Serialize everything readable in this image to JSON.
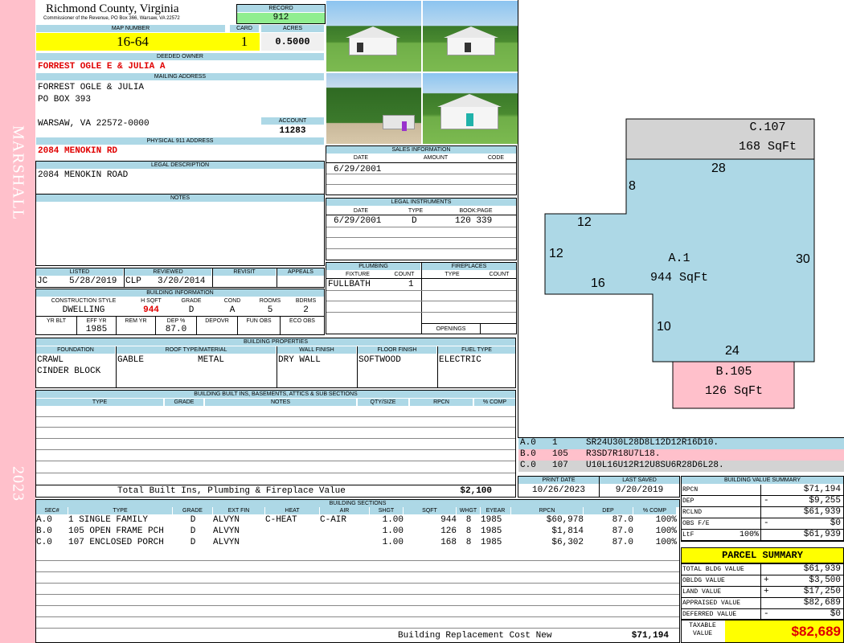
{
  "sidebar": {
    "district": "MARSHALL",
    "year": "2023"
  },
  "county": {
    "name": "Richmond County, Virginia",
    "commissioner": "Commissioner of the Revenue, PO Box 366, Warsaw, VA 22572"
  },
  "record": {
    "label": "RECORD",
    "value": "912"
  },
  "map_number": {
    "label": "MAP NUMBER",
    "value": "16-64"
  },
  "card": {
    "label": "CARD",
    "value": "1"
  },
  "acres": {
    "label": "ACRES",
    "value": "0.5000"
  },
  "deeded_owner": {
    "label": "DEEDED OWNER",
    "value": "FORREST OGLE E & JULIA A"
  },
  "mailing": {
    "label": "MAILING ADDRESS",
    "line1": "FORREST OGLE & JULIA",
    "line2": "PO BOX 393",
    "line3": "WARSAW, VA 22572-0000"
  },
  "account": {
    "label": "ACCOUNT",
    "value": "11283"
  },
  "physical": {
    "label": "PHYSICAL 911 ADDRESS",
    "value": "2084 MENOKIN RD"
  },
  "legal": {
    "label": "LEGAL DESCRIPTION",
    "value": "2084 MENOKIN ROAD"
  },
  "notes": {
    "label": "NOTES"
  },
  "sales": {
    "title": "SALES INFORMATION",
    "h_date": "DATE",
    "h_amount": "AMOUNT",
    "h_code": "CODE",
    "date": "6/29/2001"
  },
  "instruments": {
    "title": "LEGAL INSTRUMENTS",
    "h_date": "DATE",
    "h_type": "TYPE",
    "h_book": "BOOK:PAGE",
    "date": "6/29/2001",
    "type": "D",
    "book": "120 339"
  },
  "listing": {
    "h_listed": "LISTED",
    "h_reviewed": "REVIEWED",
    "h_revisit": "REVISIT",
    "h_appeals": "APPEALS",
    "listed_by": "JC",
    "listed_date": "5/28/2019",
    "reviewed_by": "CLP",
    "reviewed_date": "3/20/2014"
  },
  "plumbing": {
    "title": "PLUMBING",
    "h_fixture": "FIXTURE",
    "h_count": "COUNT",
    "fixture": "FULLBATH",
    "count": "1"
  },
  "fireplaces": {
    "title": "FIREPLACES",
    "h_type": "TYPE",
    "h_count": "COUNT",
    "openings": "OPENINGS"
  },
  "building_info": {
    "title": "BUILDING INFORMATION",
    "h_style": "CONSTRUCTION STYLE",
    "h_sqft": "H SQFT",
    "h_grade": "GRADE",
    "h_cond": "COND",
    "h_rooms": "ROOMS",
    "h_bdrms": "BDRMS",
    "style": "DWELLING",
    "sqft": "944",
    "grade": "D",
    "cond": "A",
    "rooms": "5",
    "bdrms": "2",
    "h_yrblt": "YR BLT",
    "h_effyr": "EFF YR",
    "h_remyr": "REM YR",
    "h_dep": "DEP %",
    "h_depovr": "DEPOVR",
    "h_funobs": "FUN OBS",
    "h_ecoobs": "ECO OBS",
    "effyr": "1985",
    "dep": "87.0"
  },
  "properties": {
    "title": "BUILDING PROPERTIES",
    "h_foundation": "FOUNDATION",
    "h_roof": "ROOF TYPE/MATERIAL",
    "h_wall": "WALL FINISH",
    "h_floor": "FLOOR FINISH",
    "h_fuel": "FUEL TYPE",
    "foundation1": "CRAWL",
    "foundation2": "CINDER BLOCK",
    "roof_type": "GABLE",
    "roof_mat": "METAL",
    "wall": "DRY WALL",
    "floor": "SOFTWOOD",
    "fuel": "ELECTRIC"
  },
  "builtins": {
    "title": "BUILDING BUILT INS, BASEMENTS, ATTICS & SUB SECTIONS",
    "h_type": "TYPE",
    "h_grade": "GRADE",
    "h_notes": "NOTES",
    "h_qty": "QTY/SIZE",
    "h_rpcn": "RPCN",
    "h_comp": "% COMP",
    "total_label": "Total Built Ins, Plumbing & Fireplace Value",
    "total_value": "$2,100"
  },
  "sections": {
    "title": "BUILDING SECTIONS",
    "headers": [
      "SEC#",
      "TYPE",
      "GRADE",
      "EXT FIN",
      "HEAT",
      "AIR",
      "SHGT",
      "SQFT",
      "WHGT",
      "EYEAR",
      "RPCN",
      "DEP",
      "% COMP"
    ],
    "rows": [
      [
        "A.0",
        "1 SINGLE FAMILY",
        "D",
        "ALVYN",
        "C-HEAT",
        "C-AIR",
        "1.00",
        "944",
        "8",
        "1985",
        "$60,978",
        "87.0",
        "100%"
      ],
      [
        "B.0",
        "105 OPEN FRAME PCH",
        "D",
        "ALVYN",
        "",
        "",
        "1.00",
        "126",
        "8",
        "1985",
        "$1,814",
        "87.0",
        "100%"
      ],
      [
        "C.0",
        "107 ENCLOSED PORCH",
        "D",
        "ALVYN",
        "",
        "",
        "1.00",
        "168",
        "8",
        "1985",
        "$6,302",
        "87.0",
        "100%"
      ]
    ],
    "replacement_label": "Building Replacement Cost New",
    "replacement_value": "$71,194"
  },
  "sketch": {
    "c_label": "C.107",
    "c_area": "168 SqFt",
    "a_label": "A.1",
    "a_area": "944 SqFt",
    "b_label": "B.105",
    "b_area": "126 SqFt",
    "dims": [
      "28",
      "8",
      "12",
      "12",
      "16",
      "30",
      "10",
      "24"
    ],
    "colors": {
      "a": "#add8e6",
      "b": "#ffc0cb",
      "c": "#d3d3d3"
    }
  },
  "vectors": [
    {
      "sec": "A.0",
      "num": "1",
      "code": "SR24U30L28D8L12D12R16D10."
    },
    {
      "sec": "B.0",
      "num": "105",
      "code": "R3SD7R18U7L18."
    },
    {
      "sec": "C.0",
      "num": "107",
      "code": "U10L16U12R12U8SU6R28D6L28."
    }
  ],
  "dates": {
    "h_print": "PRINT DATE",
    "h_saved": "LAST SAVED",
    "print": "10/26/2023",
    "saved": "9/20/2019"
  },
  "value_summary": {
    "title": "BUILDING VALUE SUMMARY",
    "rows": [
      {
        "label": "RPCN",
        "sign": "",
        "pct": "",
        "value": "$71,194"
      },
      {
        "label": "DEP",
        "sign": "-",
        "pct": "",
        "value": "$9,255"
      },
      {
        "label": "RCLND",
        "sign": "",
        "pct": "",
        "value": "$61,939"
      },
      {
        "label": "OBS F/E",
        "sign": "-",
        "pct": "",
        "value": "$0"
      },
      {
        "label": "LtF",
        "sign": "",
        "pct": "100%",
        "value": "$61,939"
      }
    ]
  },
  "parcel": {
    "title": "PARCEL SUMMARY",
    "rows": [
      {
        "label": "TOTAL BLDG VALUE",
        "sign": "",
        "value": "$61,939"
      },
      {
        "label": "OBLDG VALUE",
        "sign": "+",
        "value": "$3,500"
      },
      {
        "label": "LAND VALUE",
        "sign": "+",
        "value": "$17,250"
      },
      {
        "label": "APPRAISED VALUE",
        "sign": "",
        "value": "$82,689"
      },
      {
        "label": "DEFERRED VALUE",
        "sign": "-",
        "value": "$0"
      }
    ],
    "taxable_label1": "TAXABLE",
    "taxable_label2": "VALUE",
    "taxable_value": "$82,689"
  }
}
